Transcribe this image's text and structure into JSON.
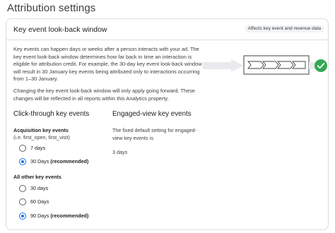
{
  "page": {
    "title": "Attribution settings"
  },
  "card": {
    "title": "Key event look-back window",
    "chip": "Affects key event and revenue data",
    "description": "Key events can happen days or weeks after a person interacts with your ad. The key event look-back window determines how far back in time an interaction is eligible for attribution credit. For example, the 30-day key event look-back window will result in 30 January key events being attributed only to interactions occurring from 1–30 January.",
    "note": "Changing the key event look-back window will only apply going forward. These changes will be reflected in all reports within this Analytics property."
  },
  "illustration": {
    "arrow_color": "#e8eaed",
    "box_border": "#3c4043",
    "check_color": "#34a853",
    "check_icon": "check-icon",
    "chevron_count": 4
  },
  "click_through": {
    "title": "Click-through key events",
    "acquisition": {
      "label": "Acquisition key events",
      "sub": "(i.e. first_open, first_visit)",
      "options": [
        {
          "label": "7 days",
          "suffix": "",
          "selected": false
        },
        {
          "label": "30 Days",
          "suffix": "(recommended)",
          "selected": true
        }
      ]
    },
    "other": {
      "label": "All other key events",
      "options": [
        {
          "label": "30 days",
          "suffix": "",
          "selected": false
        },
        {
          "label": "60 Days",
          "suffix": "",
          "selected": false
        },
        {
          "label": "90 Days",
          "suffix": "(recommended)",
          "selected": true
        }
      ]
    }
  },
  "engaged_view": {
    "title": "Engaged-view key events",
    "description": "The fixed default setting for engaged-view key events is",
    "value": "3 days"
  },
  "colors": {
    "accent": "#1a73e8",
    "border": "#dadce0",
    "text": "#202124",
    "secondary_text": "#3c4043"
  }
}
